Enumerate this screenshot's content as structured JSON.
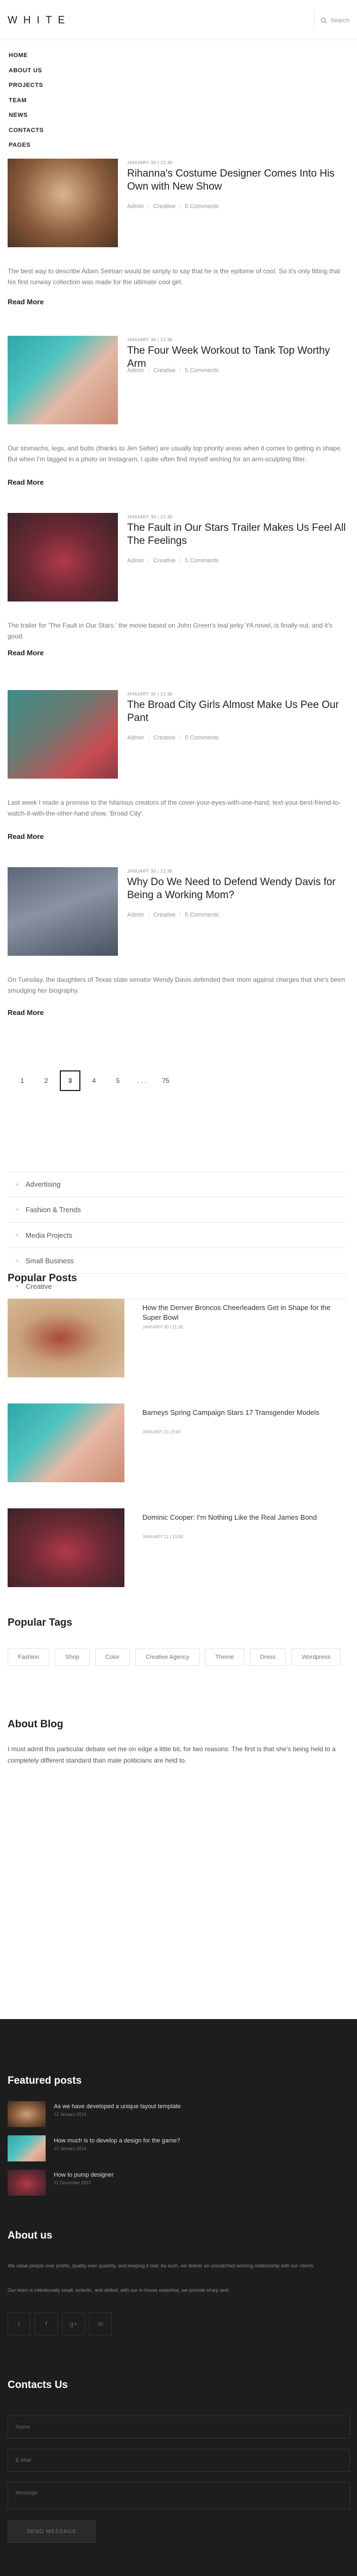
{
  "header": {
    "logo": "WHITE",
    "search_label": "Search"
  },
  "nav": {
    "items": [
      "HOME",
      "ABOUT US",
      "PROJECTS",
      "TEAM",
      "NEWS",
      "CONTACTS",
      "PAGES"
    ]
  },
  "posts": [
    {
      "date": "JANUARY 30 | 21:30",
      "title": "Rihanna's Costume Designer Comes Into His Own with New Show",
      "author": "Admin",
      "category": "Creative",
      "comments": "5 Comments",
      "excerpt": "The best way to describe Adam Selman would be simply to say that he is the epitome of cool. So it's only fitting that his first runway collection was made for the ultimate cool girl.",
      "more": "Read More"
    },
    {
      "date": "JANUARY 30 | 21:30",
      "title": "The Four Week Workout to Tank Top Worthy Arm",
      "author": "Admin",
      "category": "Creative",
      "comments": "5 Comments",
      "excerpt": "Our stomachs, legs, and butts (thanks to Jen Selter) are usually top priority areas when it comes to getting in shape. But when I'm tagged in a photo on Instagram, I quite often find myself wishing for an arm-sculpting filter.",
      "more": "Read More"
    },
    {
      "date": "JANUARY 30 | 21:30",
      "title": "The Fault in Our Stars Trailer Makes Us Feel All The Feelings",
      "author": "Admin",
      "category": "Creative",
      "comments": "5 Comments",
      "excerpt": "The trailer for 'The Fault in Our Stars,' the movie based on John Green's teal jerky YA novel, is finally out, and it's good.",
      "more": "Read More"
    },
    {
      "date": "JANUARY 30 | 21:30",
      "title": "The Broad City Girls Almost Make Us Pee Our Pant",
      "author": "Admin",
      "category": "Creative",
      "comments": "5 Comments",
      "excerpt": "Last week I made a promise to the hilarious creators of the cover-your-eyes-with-one-hand, text-your-best-friend-to-watch-it-with-the-other-hand show, 'Broad City'.",
      "more": "Read More"
    },
    {
      "date": "JANUARY 30 | 21:30",
      "title": "Why Do We Need to Defend Wendy Davis for Being a Working Mom?",
      "author": "Admin",
      "category": "Creative",
      "comments": "5 Comments",
      "excerpt": "On Tuesday, the daughters of Texas state senator Wendy Davis defended their mom against charges that she's been smudging her biography.",
      "more": "Read More"
    }
  ],
  "pagination": {
    "pages": [
      "1",
      "2",
      "3",
      "4",
      "5",
      ". . .",
      "75"
    ],
    "active": "3"
  },
  "categories": [
    "Advertising",
    "Fashion & Trends",
    "Media Projects",
    "Small Business",
    "Creative"
  ],
  "popular": {
    "title_bold": "Popular",
    "title_rest": " Posts",
    "items": [
      {
        "title": "How the Denver Broncos Cheerleaders Get in Shape for the Super Bowl",
        "date": "JANUARY 30 | 21:30"
      },
      {
        "title": "Barneys Spring Campaign Stars 17 Transgender Models",
        "date": "JANUARY 23 | 9:00"
      },
      {
        "title": "Dominic Cooper: I'm Nothing Like the Real James Bond",
        "date": "JANUARY 21 | 13:00"
      }
    ]
  },
  "tags": {
    "title_bold": "Popular",
    "title_rest": " Tags",
    "items": [
      "Fashion",
      "Shop",
      "Color",
      "Creative Agency",
      "Theme",
      "Dress",
      "Wordpress"
    ]
  },
  "about_blog": {
    "title_bold": "About",
    "title_rest": " Blog",
    "text": "I must admit this particular debate set me on edge a little bit, for two reasons: The first is that she's being held to a completely different standard than male politicians are held to."
  },
  "footer": {
    "featured": {
      "title_bold": "Featured",
      "title_rest": " posts",
      "items": [
        {
          "title": "As we have developed a unique layout template",
          "date": "12 January 2014"
        },
        {
          "title": "How much is to develop a design for the game?",
          "date": "10 January 2014"
        },
        {
          "title": "How to pump designer",
          "date": "21 December 2013"
        }
      ]
    },
    "about": {
      "title_bold": "About",
      "title_rest": " us",
      "text1": "We value people over profits, quality over quantity, and keeping it real. As such, we deliver an unmatched working relationship with our clients.",
      "text2": "Our team is intentionally small, eclectic, and skilled; with our in-house expertise, we provide sharp and"
    },
    "socials": [
      "t",
      "f",
      "g+",
      "in"
    ],
    "contacts": {
      "title_bold": "Contacts",
      "title_rest": " Us",
      "name_placeholder": "Name",
      "email_placeholder": "E-Mail",
      "message_placeholder": "Message",
      "button": "SEND MESSAGE"
    }
  },
  "colors": {
    "footer_bg": "#1d1d1d",
    "text_dark": "#222222",
    "text_muted": "#777777"
  }
}
